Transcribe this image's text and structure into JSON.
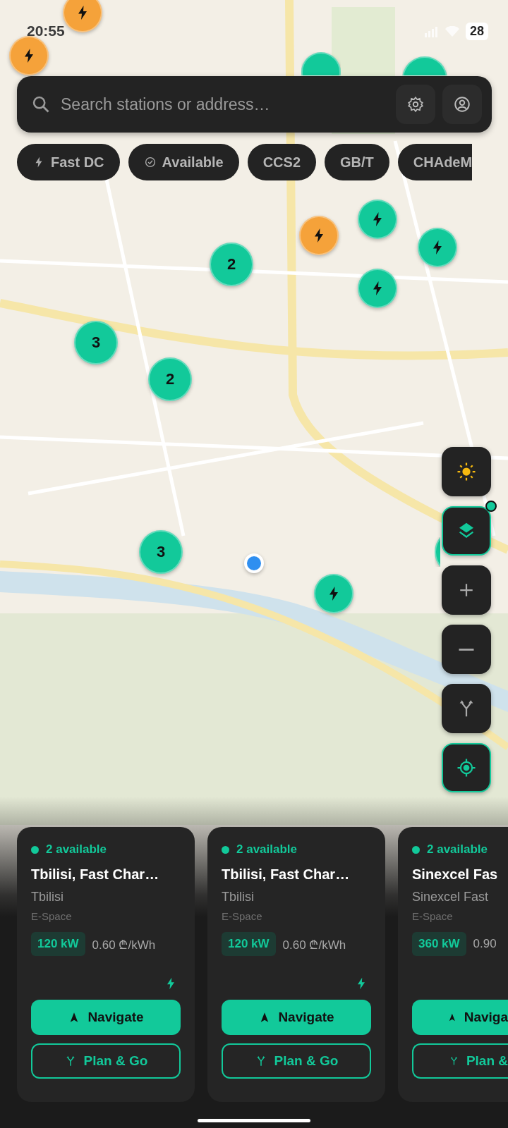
{
  "status_bar": {
    "time": "20:55",
    "battery": "28"
  },
  "search": {
    "placeholder": "Search stations or address…"
  },
  "filters": [
    {
      "kind": "bolt",
      "label": "Fast DC"
    },
    {
      "kind": "check",
      "label": "Available"
    },
    {
      "kind": "plain",
      "label": "CCS2"
    },
    {
      "kind": "plain",
      "label": "GB/T"
    },
    {
      "kind": "plain",
      "label": "CHAdeM"
    }
  ],
  "markers": [
    {
      "kind": "station",
      "color": "#f5a23a"
    },
    {
      "kind": "station",
      "color": "#f5a23a"
    },
    {
      "kind": "station",
      "color": "#12c99a"
    },
    {
      "kind": "station",
      "color": "#12c99a"
    },
    {
      "kind": "station",
      "color": "#12c99a"
    },
    {
      "kind": "station",
      "color": "#f5a23a"
    },
    {
      "kind": "station",
      "color": "#12c99a"
    },
    {
      "kind": "station",
      "color": "#12c99a"
    },
    {
      "kind": "cluster",
      "count": "2"
    },
    {
      "kind": "cluster",
      "count": "3"
    },
    {
      "kind": "cluster",
      "count": "2"
    },
    {
      "kind": "cluster",
      "count": "3"
    },
    {
      "kind": "station",
      "color": "#12c99a"
    },
    {
      "kind": "station",
      "color": "#12c99a"
    },
    {
      "kind": "user"
    }
  ],
  "map_controls": [
    {
      "kind": "theme",
      "highlighted": false
    },
    {
      "kind": "layers",
      "highlighted": true,
      "badge": true
    },
    {
      "kind": "zoom_in",
      "highlighted": false
    },
    {
      "kind": "zoom_out",
      "highlighted": false
    },
    {
      "kind": "route",
      "highlighted": false
    },
    {
      "kind": "locate",
      "highlighted": true
    }
  ],
  "cards": [
    {
      "clipped": false,
      "availability": "2 available",
      "title": "Tbilisi, Fast Char…",
      "city": "Tbilisi",
      "operator": "E-Space",
      "power": "120 kW",
      "price": "0.60 ₾/kWh",
      "actions": [
        {
          "kind": "navigate",
          "label": "Navigate"
        },
        {
          "kind": "plan",
          "label": "Plan & Go"
        }
      ]
    },
    {
      "clipped": false,
      "availability": "2 available",
      "title": "Tbilisi, Fast Char…",
      "city": "Tbilisi",
      "operator": "E-Space",
      "power": "120 kW",
      "price": "0.60 ₾/kWh",
      "actions": [
        {
          "kind": "navigate",
          "label": "Navigate"
        },
        {
          "kind": "plan",
          "label": "Plan & Go"
        }
      ]
    },
    {
      "clipped": true,
      "availability": "2 available",
      "title": "Sinexcel Fas",
      "city": "Sinexcel Fast",
      "operator": "E-Space",
      "power": "360 kW",
      "price": "0.90",
      "actions": [
        {
          "kind": "navigate",
          "label": "Naviga"
        },
        {
          "kind": "plan",
          "label": "Plan &"
        }
      ]
    }
  ]
}
